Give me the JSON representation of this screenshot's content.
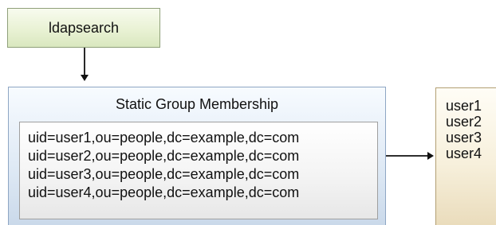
{
  "ldap_box": {
    "label": "ldapsearch"
  },
  "group_box": {
    "title": "Static Group Membership",
    "members": [
      "uid=user1,ou=people,dc=example,dc=com",
      "uid=user2,ou=people,dc=example,dc=com",
      "uid=user3,ou=people,dc=example,dc=com",
      "uid=user4,ou=people,dc=example,dc=com"
    ]
  },
  "users_box": {
    "users": [
      "user1",
      "user2",
      "user3",
      "user4"
    ]
  },
  "colors": {
    "ldap_fill": "#e9f2d4",
    "group_fill": "#dde8f4",
    "users_fill": "#f7f0dc",
    "arrow": "#111111"
  }
}
